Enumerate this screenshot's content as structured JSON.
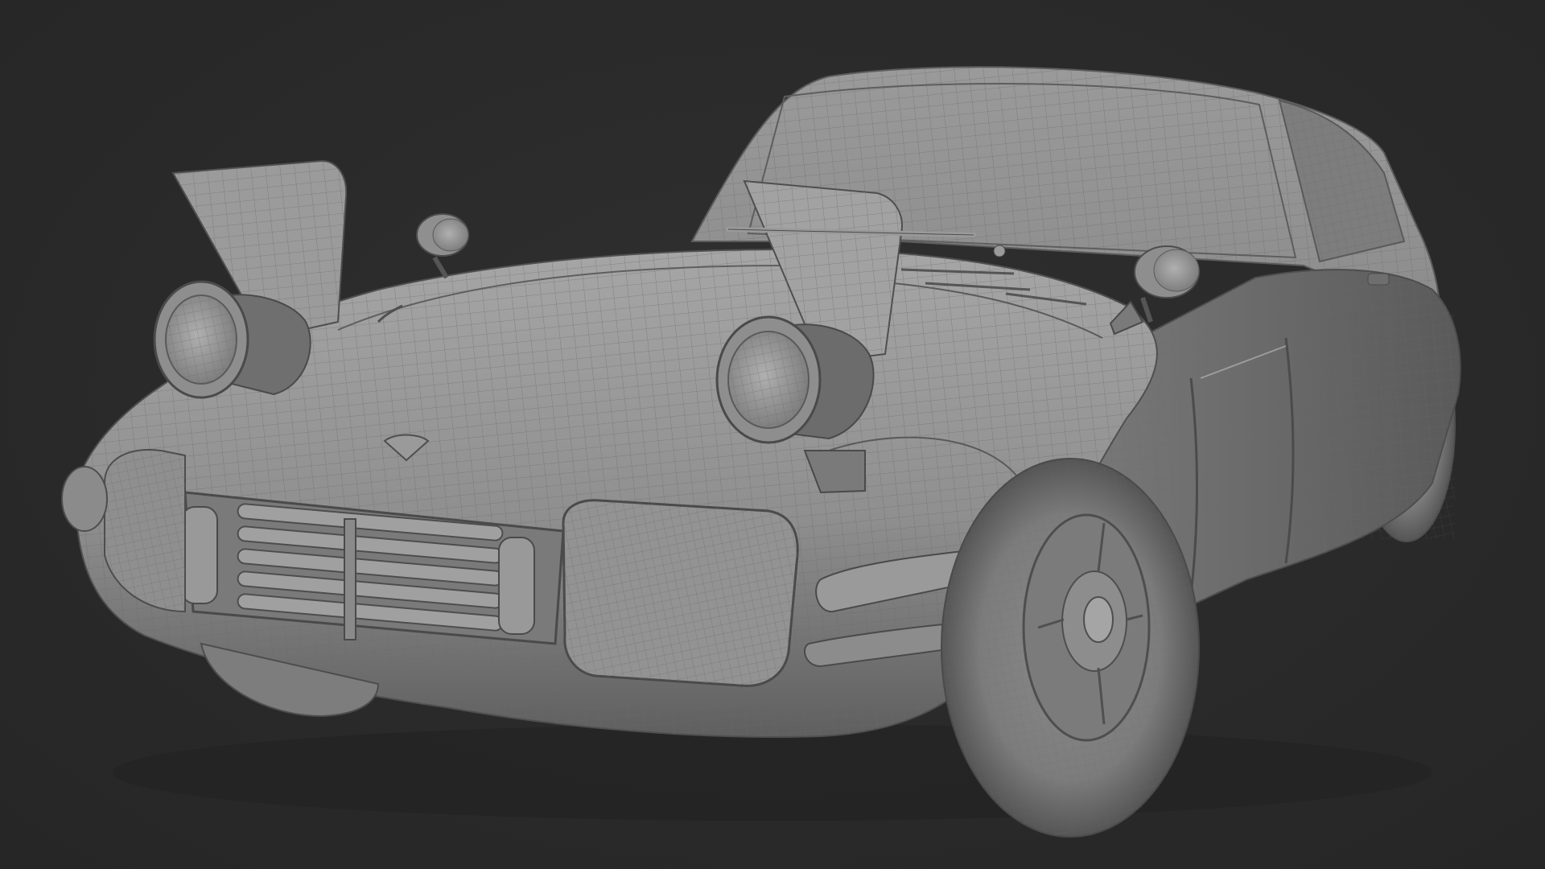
{
  "viewport": {
    "background_color": "#2b2b2b",
    "subject": "car-wireframe-model"
  },
  "model": {
    "base_color": "#8a8a8a",
    "highlight_color": "#a3a3a3",
    "shadow_color": "#5e5e5e",
    "wire_color": "#6d6d6d"
  }
}
